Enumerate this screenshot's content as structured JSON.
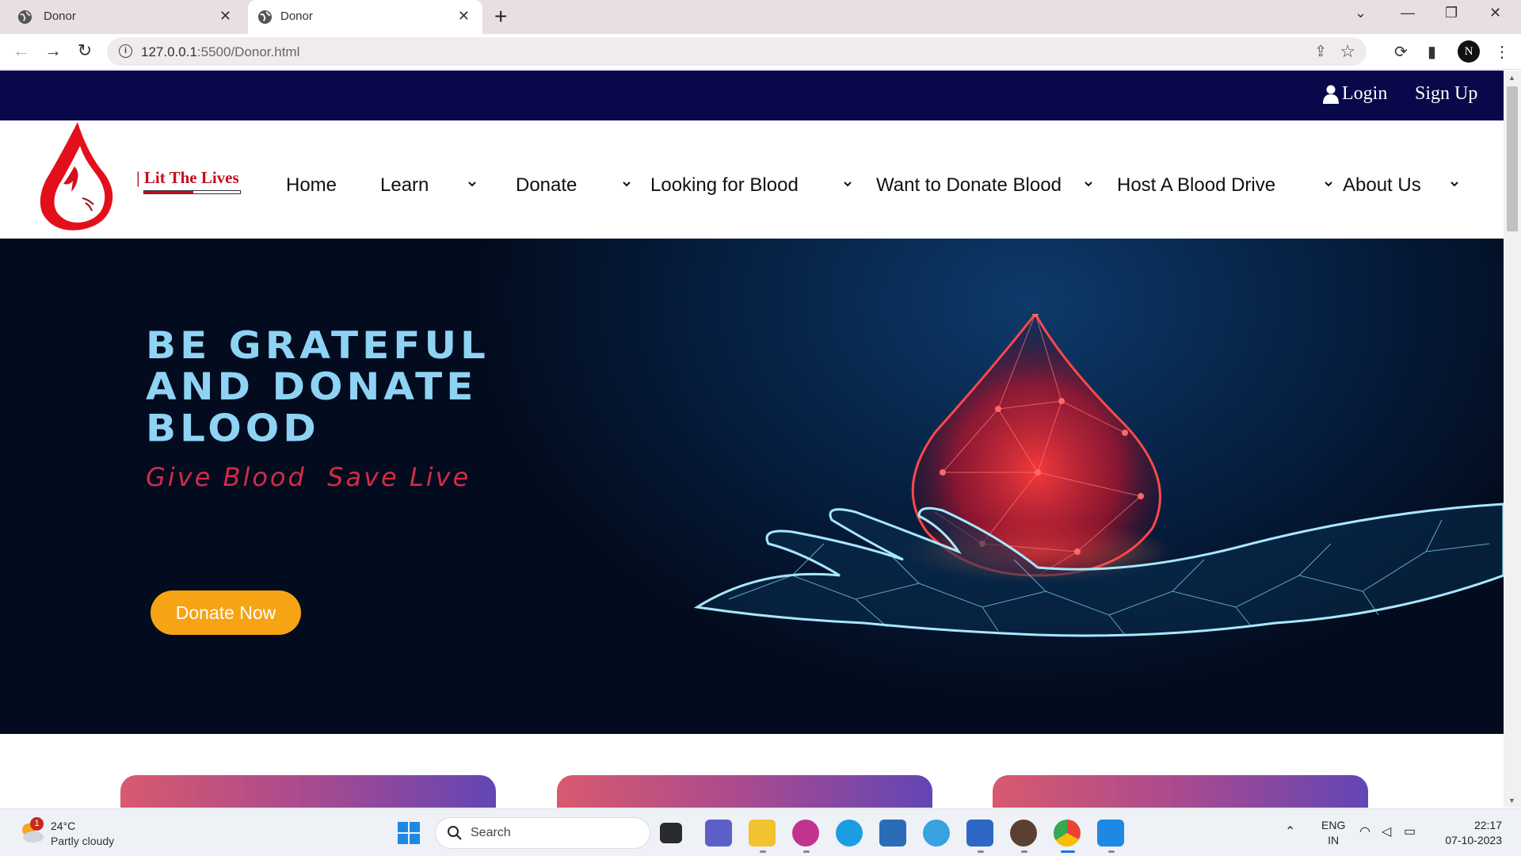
{
  "browser": {
    "tabs": [
      {
        "title": "Donor",
        "active": false
      },
      {
        "title": "Donor",
        "active": true
      }
    ],
    "url_host": "127.0.0.1",
    "url_path": ":5500/Donor.html",
    "profile_initial": "N"
  },
  "topbar": {
    "login_label": "Login",
    "signup_label": "Sign Up"
  },
  "brand": {
    "name": "| Lit The Lives"
  },
  "nav": {
    "items": [
      {
        "label": "Home"
      },
      {
        "label": "Learn"
      },
      {
        "label": "Donate"
      },
      {
        "label": "Looking for Blood"
      },
      {
        "label": "Want to Donate Blood"
      },
      {
        "label": "Host A Blood Drive"
      },
      {
        "label": "About Us"
      }
    ]
  },
  "hero": {
    "title_lines": [
      "BE GRATEFUL",
      "AND DONATE",
      "BLOOD"
    ],
    "subtitle": "Give Blood  Save Live",
    "cta_label": "Donate Now"
  },
  "taskbar": {
    "weather_temp": "24°C",
    "weather_condition": "Partly cloudy",
    "weather_badge": "1",
    "search_placeholder": "Search",
    "lang_line1": "ENG",
    "lang_line2": "IN",
    "time": "22:17",
    "date": "07-10-2023"
  },
  "colors": {
    "topbar_bg": "#08084a",
    "brand_red": "#c1121f",
    "hero_title": "#8fd3f4",
    "hero_subtitle": "#d42a45",
    "cta_bg": "#f6a314"
  }
}
